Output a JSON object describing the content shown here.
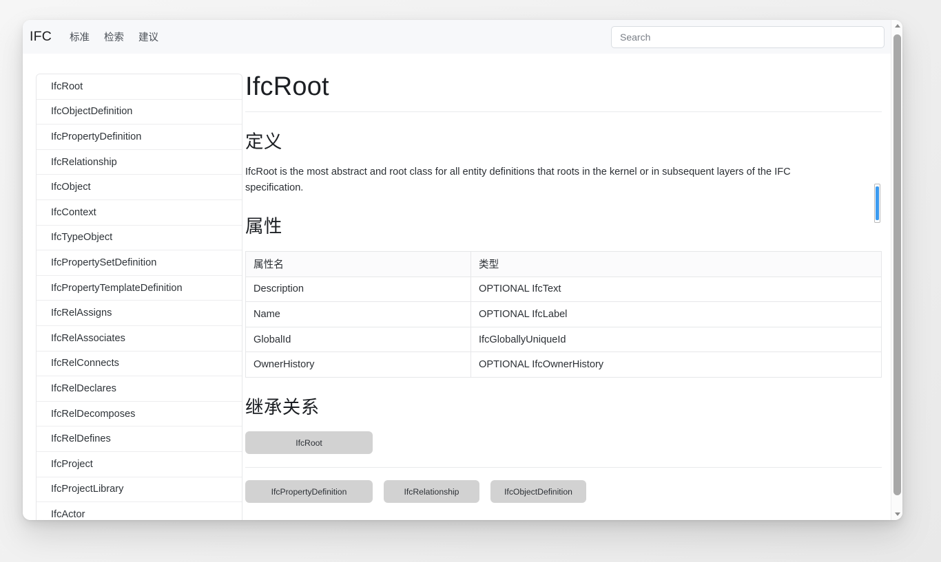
{
  "header": {
    "brand": "IFC",
    "nav": [
      {
        "label": "标准",
        "name": "nav-item-standard"
      },
      {
        "label": "检索",
        "name": "nav-item-search"
      },
      {
        "label": "建议",
        "name": "nav-item-suggest"
      }
    ],
    "search": {
      "placeholder": "Search",
      "value": ""
    }
  },
  "sidebar": {
    "items": [
      {
        "label": "IfcRoot"
      },
      {
        "label": "IfcObjectDefinition"
      },
      {
        "label": "IfcPropertyDefinition"
      },
      {
        "label": "IfcRelationship"
      },
      {
        "label": "IfcObject"
      },
      {
        "label": "IfcContext"
      },
      {
        "label": "IfcTypeObject"
      },
      {
        "label": "IfcPropertySetDefinition"
      },
      {
        "label": "IfcPropertyTemplateDefinition"
      },
      {
        "label": "IfcRelAssigns"
      },
      {
        "label": "IfcRelAssociates"
      },
      {
        "label": "IfcRelConnects"
      },
      {
        "label": "IfcRelDeclares"
      },
      {
        "label": "IfcRelDecomposes"
      },
      {
        "label": "IfcRelDefines"
      },
      {
        "label": "IfcProject"
      },
      {
        "label": "IfcProjectLibrary"
      },
      {
        "label": "IfcActor"
      }
    ]
  },
  "main": {
    "title": "IfcRoot",
    "definition": {
      "heading": "定义",
      "text": "IfcRoot is the most abstract and root class for all entity definitions that roots in the kernel or in subsequent layers of the IFC specification."
    },
    "attributes": {
      "heading": "属性",
      "columns": [
        "属性名",
        "类型"
      ],
      "rows": [
        {
          "name": "Description",
          "type": "OPTIONAL IfcText"
        },
        {
          "name": "Name",
          "type": "OPTIONAL IfcLabel"
        },
        {
          "name": "GlobalId",
          "type": "IfcGloballyUniqueId"
        },
        {
          "name": "OwnerHistory",
          "type": "OPTIONAL IfcOwnerHistory"
        }
      ]
    },
    "inheritance": {
      "heading": "继承关系",
      "parent": "IfcRoot",
      "children": [
        "IfcPropertyDefinition",
        "IfcRelationship",
        "IfcObjectDefinition"
      ]
    }
  },
  "colors": {
    "header_bg": "#f7f8fa",
    "node_bg": "#d2d2d2",
    "accent": "#3b9bf0",
    "border": "#e6e7e9"
  }
}
